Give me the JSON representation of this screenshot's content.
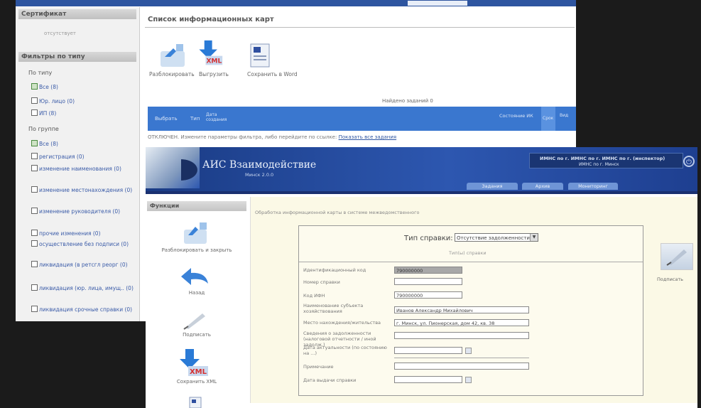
{
  "back_window": {
    "certificate_header": "Сертификат",
    "certificate_value": "отсутствует",
    "filters_header": "Фильтры по типу",
    "by_type_label": "По типу",
    "type_items": [
      "Все (8)",
      "Юр. лицо (0)",
      "ИП (8)"
    ],
    "by_group_label": "По группе",
    "group_items": [
      "Все (8)",
      "регистрация (0)",
      "изменение наименования (0)",
      "изменение местонахождения (0)",
      "изменение руководителя (0)",
      "прочие изменения (0)",
      "осуществление без подписи (0)",
      "ликвидация (в ретсгл реорг (0)",
      "ликвидация (юр. лица, имущ.. (0)",
      "ликвидация срочные справки (0)"
    ],
    "list_title": "Список информационных карт",
    "toolbar": [
      "Разблокировать",
      "Выгрузить",
      "Сохранить в Word"
    ],
    "found": "Найдено заданий 0",
    "table_headers": [
      "Выбрать",
      "Тип",
      "Дата создания",
      "Состояние ИК",
      "Срок",
      "Вид"
    ],
    "footer_text": "ОТКЛЮЧЕН. Измените параметры фильтра, либо перейдите по ссылке:",
    "footer_link": "Показать все задания"
  },
  "front_window": {
    "app_title": "АИС Взаимодействие",
    "app_subtitle": "Минск 2.0.0",
    "user_line1": "ИМНС по г. ИМНС по г. ИМНС по г. (инспектор)",
    "user_line2": "ИМНС по г. Минск",
    "close_icon": "close-icon",
    "nav_tabs": [
      "Задания",
      "Архив",
      "Мониторинг"
    ],
    "functions_header": "Функции",
    "functions": [
      "Разблокировать и закрыть",
      "Назад",
      "Подписать",
      "Сохранить XML"
    ],
    "content_title": "Обработка информационной карты в системе межведомственного",
    "doc_type_label": "Тип справки:",
    "doc_type_value": "Отсутствие задолженности",
    "form_sub": "Тип(ы) справки",
    "fields": [
      {
        "label": "Идентификационный код",
        "value": "790000000"
      },
      {
        "label": "Номер справки",
        "value": ""
      },
      {
        "label": "Код ИФН",
        "value": "790000000"
      },
      {
        "label": "Наименование субъекта хозяйствования",
        "value": "Иванов Александр Михайлович"
      },
      {
        "label": "Место нахождения/жительства",
        "value": "г. Минск, ул. Пионерская, дом 42, кв. 38"
      },
      {
        "label": "Сведения о задолженности (налоговой отчетности / иной задолж.)",
        "value": ""
      },
      {
        "label": "Дата актуальности (по состоянию на ...)",
        "value": ""
      },
      {
        "label": "Примечание",
        "value": ""
      },
      {
        "label": "Дата выдачи справки",
        "value": ""
      }
    ],
    "print_label": "Подписать"
  }
}
